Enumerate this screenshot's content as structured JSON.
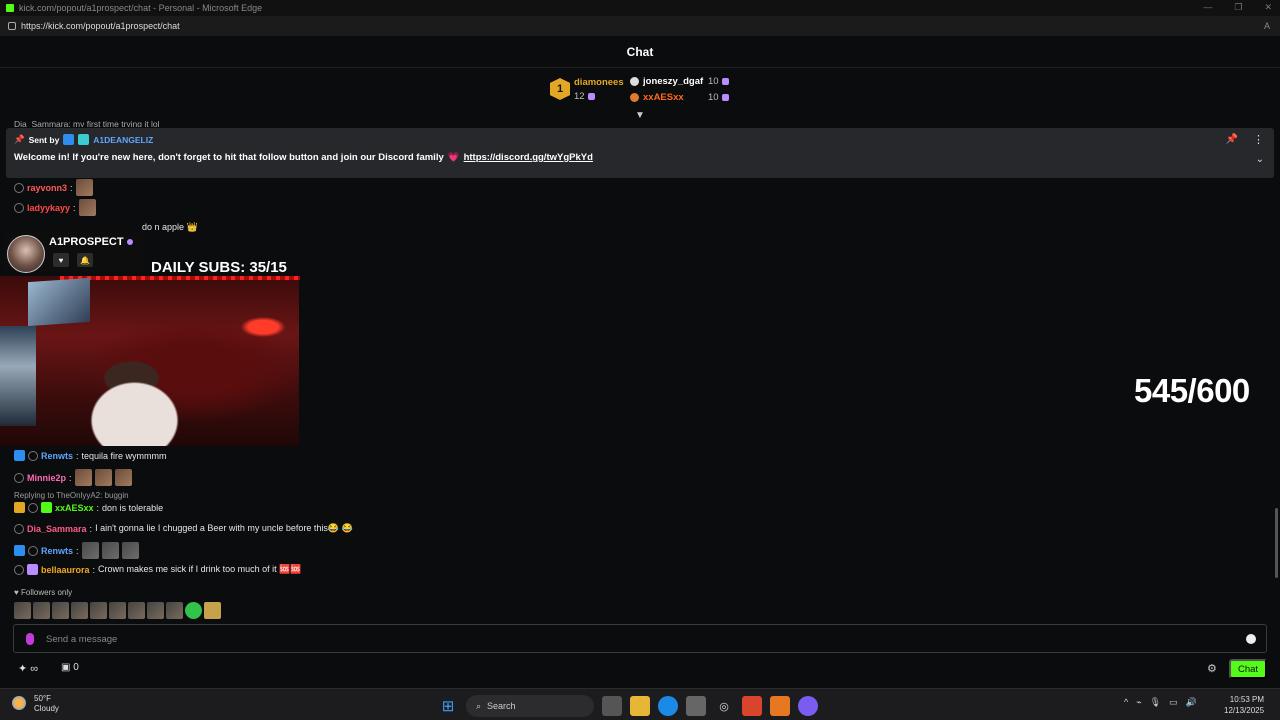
{
  "window": {
    "title": "kick.com/popout/a1prospect/chat - Personal - Microsoft Edge",
    "url": "https://kick.com/popout/a1prospect/chat"
  },
  "chat": {
    "header": "Chat",
    "leaderboard": [
      {
        "rank": "1",
        "name": "diamonees",
        "count": "12"
      },
      {
        "name": "joneszy_dgaf",
        "count": "10"
      },
      {
        "name": "xxAESxx",
        "count": "10"
      }
    ],
    "partial_message": "Dia_Sammara: my first time trying it lol",
    "pinned": {
      "sent_by_label": "Sent by",
      "user": "A1DEANGELIZ",
      "message": "Welcome in! If you're new here, don't forget to hit that follow button and join our Discord family",
      "link": "https://discord.gg/twYgPkYd"
    },
    "messages": [
      {
        "user": "rayvonn3",
        "text": "",
        "color": "#ff5a5a"
      },
      {
        "user": "ladyykayy",
        "text": "",
        "color": "#ff4a4a"
      },
      {
        "user": "",
        "text": "do n apple 👑",
        "color": "#e6e6e6"
      },
      {
        "user": "Renwts",
        "text": "tequila fire wymmmm",
        "color": "#5ea6ff"
      },
      {
        "user": "Minnie2p",
        "text": "",
        "color": "#ff69b4"
      },
      {
        "user": "xxAESxx",
        "text": "don is tolerable",
        "color": "#53fc18"
      },
      {
        "user": "Dia_Sammara",
        "text": "I ain't gonna lie I chugged a Beer with my uncle before this😂 😂",
        "color": "#ff5a8a"
      },
      {
        "user": "Renwts",
        "text": "",
        "color": "#5ea6ff"
      },
      {
        "user": "bellaaurora",
        "text": "Crown makes me sick if I drink too much of it 🆘🆘",
        "color": "#f5a623"
      }
    ],
    "reply_text": "Replying to TheOnlyyA2: buggin",
    "followers_only": "Followers only",
    "input_placeholder": "Send a message",
    "chat_button": "Chat",
    "gift_count": "0"
  },
  "overlay": {
    "streamer_name": "A1PROSPECT",
    "daily_subs": "DAILY SUBS: 35/15",
    "viewer_goal": "545/600"
  },
  "taskbar": {
    "weather_temp": "50°F",
    "weather_desc": "Cloudy",
    "search_label": "Search",
    "time": "10:53 PM",
    "date": "12/13/2025"
  },
  "colors": {
    "kick_green": "#53fc18",
    "background": "#0b0c0d",
    "gold": "#e3a823"
  }
}
